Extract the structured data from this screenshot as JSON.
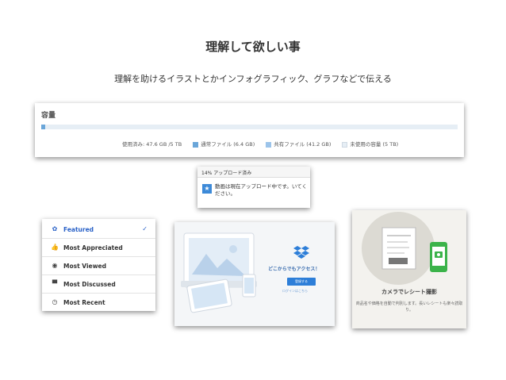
{
  "slide": {
    "title": "理解して欲しい事",
    "subtitle": "理解を助けるイラストとかインフォグラフィック、グラフなどで伝える"
  },
  "storage": {
    "heading": "容量",
    "used_label": "使用済み: 47.6 GB /5 TB",
    "used_fraction": 0.01,
    "legend": [
      {
        "label": "通常ファイル (6.4 GB)",
        "color": "#6aa6d9"
      },
      {
        "label": "共有ファイル (41.2 GB)",
        "color": "#9cc4ea"
      },
      {
        "label": "未使用の容量 (5 TB)",
        "color": "#e6eef5"
      }
    ]
  },
  "upload": {
    "header": "14% アップロード済み",
    "message": "動画は現在アップロード中です。いてください。",
    "progress_percent": 14
  },
  "menu": {
    "items": [
      {
        "label": "Featured",
        "icon": "ribbon-icon",
        "selected": true
      },
      {
        "label": "Most Appreciated",
        "icon": "thumbs-up-icon",
        "selected": false
      },
      {
        "label": "Most Viewed",
        "icon": "eye-icon",
        "selected": false
      },
      {
        "label": "Most Discussed",
        "icon": "speech-bubble-icon",
        "selected": false
      },
      {
        "label": "Most Recent",
        "icon": "clock-icon",
        "selected": false
      }
    ]
  },
  "dropbox": {
    "tagline": "どこからでもアクセス！",
    "button_label": "登録する",
    "link_text": "ログインはこちら"
  },
  "camera": {
    "title": "カメラでレシート撮影",
    "description": "商品名や価格を自動で判別します。長いレシートも楽々読取り。"
  }
}
